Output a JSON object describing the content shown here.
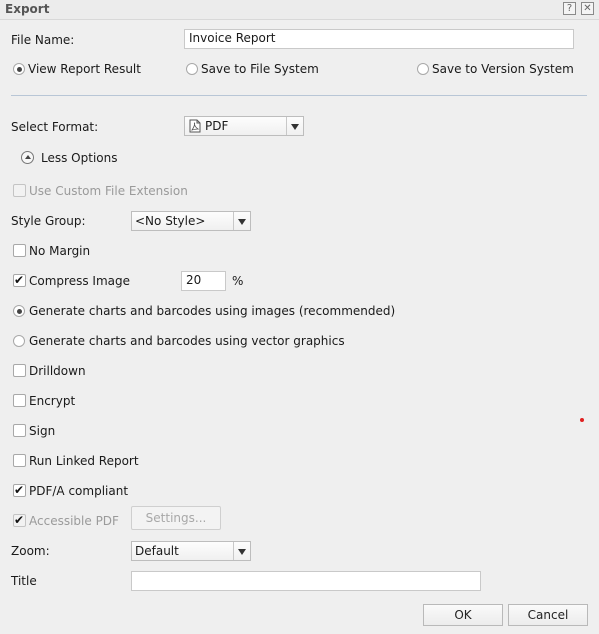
{
  "dialog": {
    "title": "Export",
    "help_icon": "?",
    "close_icon": "✕"
  },
  "file_name": {
    "label": "File Name:",
    "value": "Invoice Report"
  },
  "destination": {
    "options": [
      {
        "label": "View Report Result",
        "checked": true
      },
      {
        "label": "Save to File System",
        "checked": false
      },
      {
        "label": "Save to Version System",
        "checked": false
      }
    ]
  },
  "format": {
    "label": "Select Format:",
    "value": "PDF",
    "icon": "pdf-icon"
  },
  "less_options": {
    "label": "Less Options"
  },
  "custom_ext": {
    "label": "Use Custom File Extension",
    "checked": false,
    "disabled": true
  },
  "style_group": {
    "label": "Style Group:",
    "value": "<No Style>"
  },
  "no_margin": {
    "label": "No Margin",
    "checked": false
  },
  "compress_image": {
    "label": "Compress Image",
    "checked": true,
    "value": "20",
    "unit": "%"
  },
  "chart_mode": {
    "options": [
      {
        "label": "Generate charts and barcodes using images (recommended)",
        "checked": true
      },
      {
        "label": "Generate charts and barcodes using vector graphics",
        "checked": false
      }
    ]
  },
  "drilldown": {
    "label": "Drilldown",
    "checked": false
  },
  "encrypt": {
    "label": "Encrypt",
    "checked": false
  },
  "sign": {
    "label": "Sign",
    "checked": false
  },
  "run_linked": {
    "label": "Run Linked Report",
    "checked": false
  },
  "pdfa": {
    "label": "PDF/A compliant",
    "checked": true
  },
  "accessible": {
    "label": "Accessible PDF",
    "checked": true,
    "disabled": true,
    "settings_label": "Settings..."
  },
  "zoom": {
    "label": "Zoom:",
    "value": "Default"
  },
  "title_field": {
    "label": "Title",
    "value": ""
  },
  "buttons": {
    "ok": "OK",
    "cancel": "Cancel"
  }
}
